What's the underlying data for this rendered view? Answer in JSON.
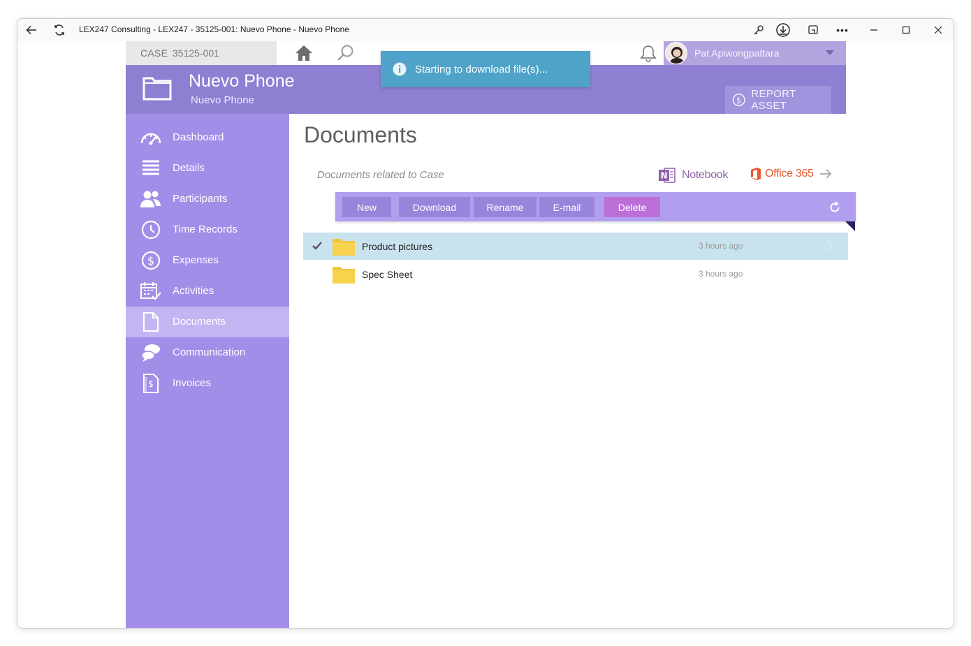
{
  "window": {
    "title": "LEX247 Consulting - LEX247 - 35125-001: Nuevo Phone - Nuevo Phone"
  },
  "topbar": {
    "case_label": "CASE",
    "case_number": "35125-001",
    "user_name": "Pat Apiwongpattara"
  },
  "header": {
    "title": "Nuevo Phone",
    "subtitle": "Nuevo Phone",
    "report_label": "REPORT ASSET"
  },
  "sidebar": {
    "items": [
      {
        "label": "Dashboard",
        "icon": "gauge-icon"
      },
      {
        "label": "Details",
        "icon": "list-icon"
      },
      {
        "label": "Participants",
        "icon": "people-icon"
      },
      {
        "label": "Time Records",
        "icon": "clock-icon"
      },
      {
        "label": "Expenses",
        "icon": "dollar-icon"
      },
      {
        "label": "Activities",
        "icon": "calendar-icon"
      },
      {
        "label": "Documents",
        "icon": "document-icon",
        "active": true
      },
      {
        "label": "Communication",
        "icon": "chat-icon"
      },
      {
        "label": "Invoices",
        "icon": "invoice-icon"
      }
    ]
  },
  "content": {
    "title": "Documents",
    "related_text": "Documents related to Case",
    "notebook_label": "Notebook",
    "office_label": "Office 365"
  },
  "toolbar": {
    "new_label": "New",
    "download_label": "Download",
    "rename_label": "Rename",
    "email_label": "E-mail",
    "delete_label": "Delete"
  },
  "files": [
    {
      "name": "Product pictures",
      "time": "3 hours ago",
      "selected": true
    },
    {
      "name": "Spec Sheet",
      "time": "3 hours ago",
      "selected": false
    }
  ],
  "toast": {
    "message": "Starting to download file(s)..."
  },
  "colors": {
    "header": "#8e7fd2",
    "sidebar": "#a28de8",
    "toolbar": "#b19eef",
    "delete": "#bd6fd8",
    "toast": "#4fa3c8",
    "selected_row": "#c9e3ee"
  }
}
